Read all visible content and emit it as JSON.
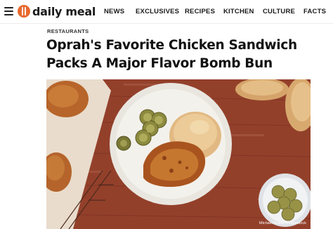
{
  "brand": {
    "name": "daily meal",
    "accent_color": "#e8682c"
  },
  "nav": {
    "menu_icon": "hamburger-icon",
    "items": [
      {
        "label": "NEWS"
      },
      {
        "label": "EXCLUSIVES"
      },
      {
        "label": "RECIPES"
      },
      {
        "label": "KITCHEN"
      },
      {
        "label": "CULTURE"
      },
      {
        "label": "FACTS"
      }
    ]
  },
  "article": {
    "category": "RESTAURANTS",
    "title_line1": "Oprah's Favorite Chicken Sandwich",
    "title_line2": "Packs A Major Flavor Bomb Bun",
    "image_credit": "Michael Kraus/Shutterstock"
  }
}
